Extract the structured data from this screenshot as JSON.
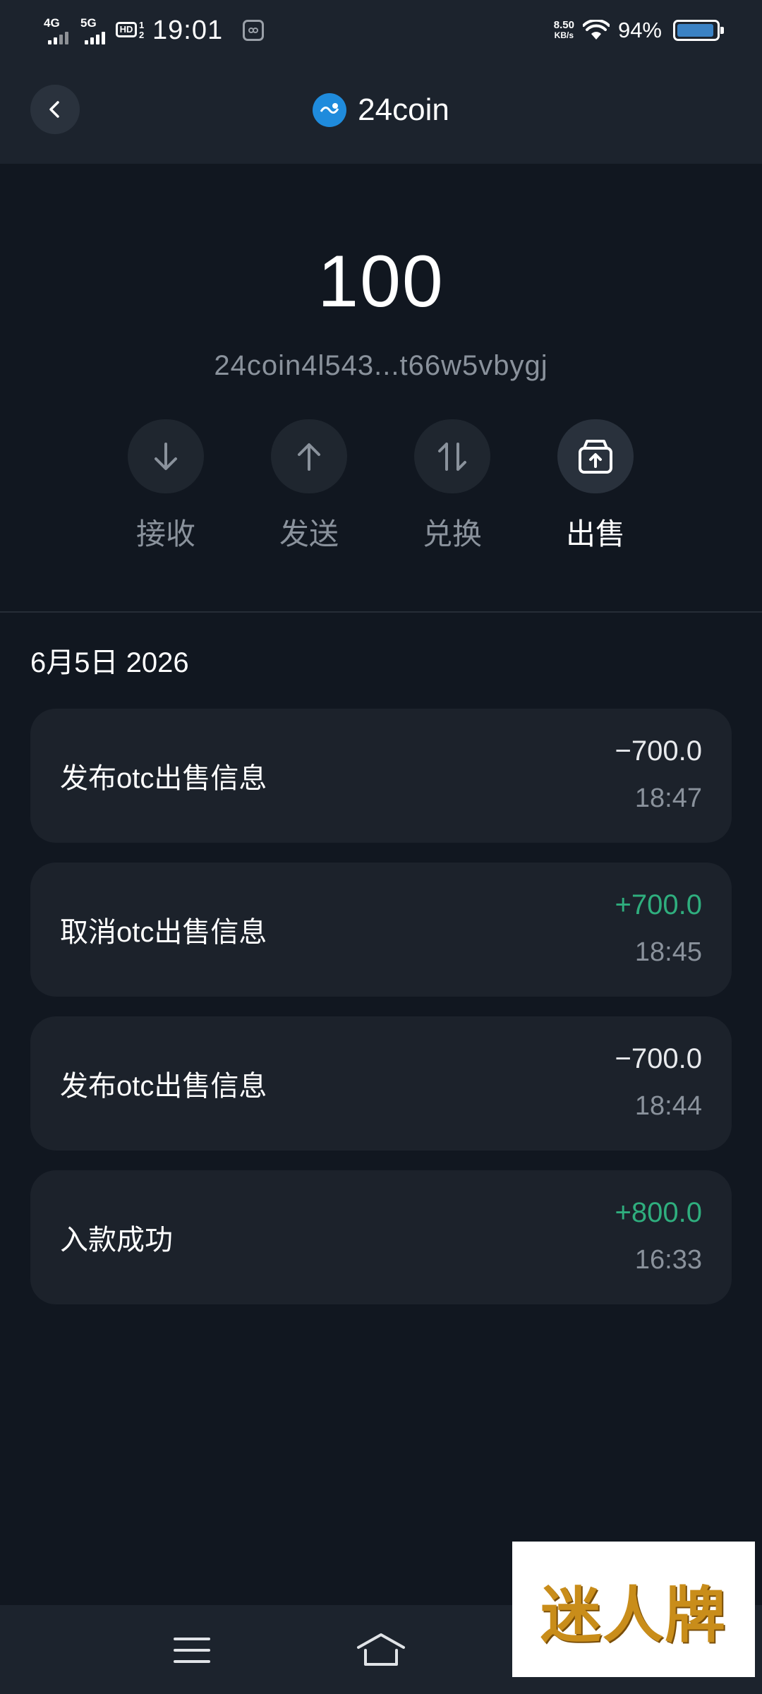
{
  "status_bar": {
    "network1": "4G",
    "network2": "5G",
    "hd_label": "HD",
    "hd_sub1": "1",
    "hd_sub2": "2",
    "time": "19:01",
    "net_speed_value": "8.50",
    "net_speed_unit": "KB/s",
    "battery_percent": "94%",
    "battery_level": 0.94
  },
  "header": {
    "title": "24coin",
    "back_icon": "chevron-left-icon",
    "logo_icon": "24coin-logo-icon"
  },
  "wallet": {
    "balance": "100",
    "address": "24coin4l543...t66w5vbygj"
  },
  "actions": [
    {
      "label": "接收",
      "icon": "arrow-down-icon",
      "active": false
    },
    {
      "label": "发送",
      "icon": "arrow-up-icon",
      "active": false
    },
    {
      "label": "兑换",
      "icon": "swap-icon",
      "active": false
    },
    {
      "label": "出售",
      "icon": "sell-box-icon",
      "active": true
    }
  ],
  "transactions": {
    "date_heading": "6月5日 2026",
    "items": [
      {
        "description": "发布otc出售信息",
        "amount": "−700.0",
        "time": "18:47",
        "positive": false
      },
      {
        "description": "取消otc出售信息",
        "amount": "+700.0",
        "time": "18:45",
        "positive": true
      },
      {
        "description": "发布otc出售信息",
        "amount": "−700.0",
        "time": "18:44",
        "positive": false
      },
      {
        "description": "入款成功",
        "amount": "+800.0",
        "time": "16:33",
        "positive": true
      }
    ]
  },
  "colors": {
    "background": "#111720",
    "header": "#1c232d",
    "card": "#1c222b",
    "positive": "#2fae7e",
    "muted": "#8a929c",
    "logo": "#1f8bdc"
  },
  "watermark": {
    "text": "迷人牌"
  }
}
